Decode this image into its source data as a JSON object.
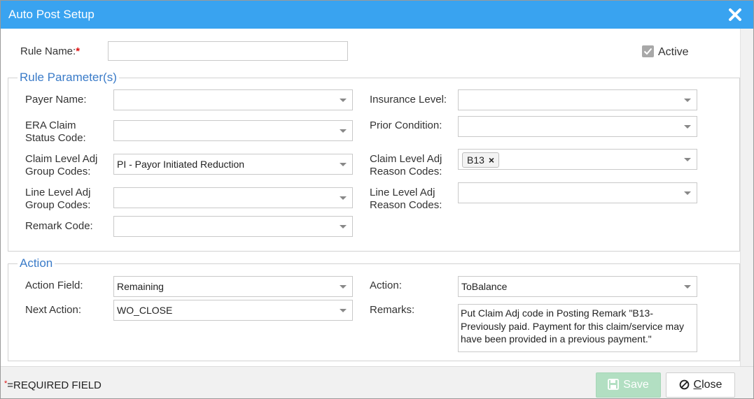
{
  "dialog": {
    "title": "Auto Post Setup",
    "close_icon": "close-x-icon"
  },
  "rule": {
    "name_label": "Rule Name:",
    "required_marker": "*",
    "name_value": "",
    "active_label": "Active",
    "active_checked": true
  },
  "rule_parameters": {
    "legend": "Rule Parameter(s)",
    "payer_name": {
      "label": "Payer Name:",
      "value": ""
    },
    "insurance_level": {
      "label": "Insurance Level:",
      "value": ""
    },
    "era_claim_status": {
      "label_line1": "ERA Claim",
      "label_line2": "Status Code:",
      "value": ""
    },
    "prior_condition": {
      "label": "Prior Condition:",
      "value": ""
    },
    "claim_adj_group": {
      "label_line1": "Claim Level Adj",
      "label_line2": "Group Codes:",
      "value": "PI - Payor Initiated Reduction"
    },
    "claim_adj_reason": {
      "label_line1": "Claim Level Adj",
      "label_line2": "Reason Codes:",
      "chips": [
        "B13"
      ],
      "chip_remove": "×"
    },
    "line_adj_group": {
      "label_line1": "Line Level Adj",
      "label_line2": "Group Codes:",
      "value": ""
    },
    "line_adj_reason": {
      "label_line1": "Line Level Adj",
      "label_line2": "Reason Codes:",
      "value": ""
    },
    "remark_code": {
      "label": "Remark Code:",
      "value": ""
    }
  },
  "action": {
    "legend": "Action",
    "action_field": {
      "label": "Action Field:",
      "value": "Remaining"
    },
    "action": {
      "label": "Action:",
      "value": "ToBalance"
    },
    "next_action": {
      "label": "Next Action:",
      "value": "WO_CLOSE"
    },
    "remarks": {
      "label": "Remarks:",
      "value": "Put Claim Adj code in Posting Remark \"B13-Previously paid. Payment for this claim/service may have been provided in a previous payment.\""
    }
  },
  "footer": {
    "required_star": "*",
    "required_text": "=REQUIRED FIELD",
    "save_label": "Save",
    "close_label_first": "C",
    "close_label_rest": "lose"
  },
  "colors": {
    "title_bar": "#39a3f0",
    "legend_text": "#3a7bc8",
    "save_button": "#b2dfc2",
    "required": "#dd1111"
  }
}
